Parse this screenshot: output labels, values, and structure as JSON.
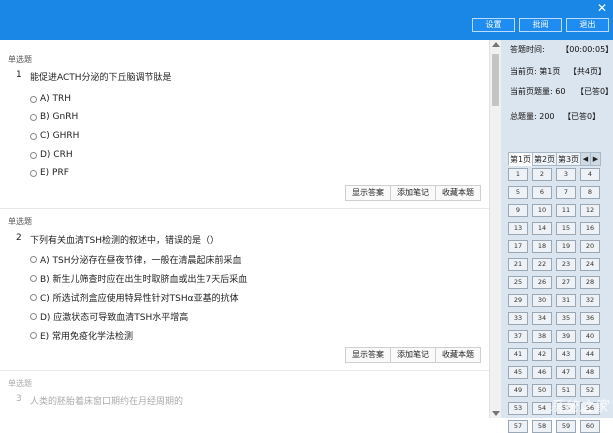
{
  "toolbar": {
    "close": "✕",
    "buttons": [
      "设置",
      "批阅",
      "退出"
    ]
  },
  "questions": [
    {
      "type": "单选题",
      "number": "1",
      "text": "能促进ACTH分泌的下丘脑调节肽是",
      "options": [
        "A) TRH",
        "B) GnRH",
        "C) GHRH",
        "D) CRH",
        "E) PRF"
      ]
    },
    {
      "type": "单选题",
      "number": "2",
      "text": "下列有关血清TSH检测的叙述中，错误的是（）",
      "options": [
        "A) TSH分泌存在昼夜节律，一般在清晨起床前采血",
        "B) 新生儿筛查时应在出生时取脐血或出生7天后采血",
        "C) 所选试剂盒应使用特异性针对TSHα亚基的抗体",
        "D) 应激状态可导致血清TSH水平增高",
        "E) 常用免疫化学法检测"
      ]
    },
    {
      "type": "单选题",
      "number": "3",
      "text": "人类的胚胎着床窗口期约在月经周期的"
    }
  ],
  "actions": [
    "显示答案",
    "添加笔记",
    "收藏本题"
  ],
  "panel": {
    "time_label": "答题时间:",
    "time_value": "【00:00:05】",
    "page_label": "当前页: 第1页",
    "page_total": "【共4页】",
    "page_count_label": "当前页题量: 60",
    "page_answered": "【已答0】",
    "total_label": "总题量: 200",
    "total_answered": "【已答0】",
    "tabs": [
      "第1页",
      "第2页",
      "第3页"
    ],
    "tab_nav": [
      "◀",
      "▶"
    ],
    "cells": [
      "1",
      "2",
      "3",
      "4",
      "5",
      "6",
      "7",
      "8",
      "9",
      "10",
      "11",
      "12",
      "13",
      "14",
      "15",
      "16",
      "17",
      "18",
      "19",
      "20",
      "21",
      "22",
      "23",
      "24",
      "25",
      "26",
      "27",
      "28",
      "29",
      "30",
      "31",
      "32",
      "33",
      "34",
      "35",
      "36",
      "37",
      "38",
      "39",
      "40",
      "41",
      "42",
      "43",
      "44",
      "45",
      "46",
      "47",
      "48",
      "49",
      "50",
      "51",
      "52",
      "53",
      "54",
      "55",
      "56",
      "57",
      "58",
      "59",
      "60"
    ]
  },
  "watermark": "系统之家"
}
